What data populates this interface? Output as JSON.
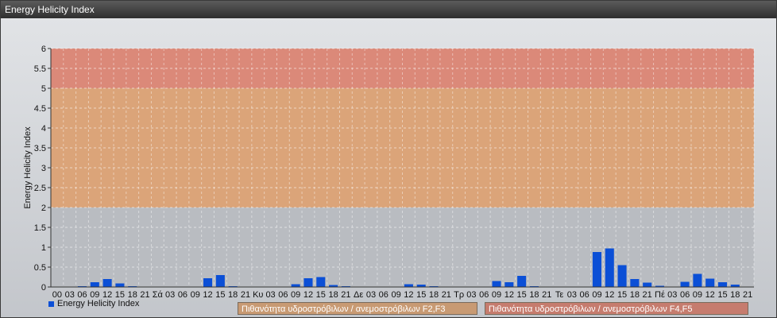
{
  "window": {
    "title": "Energy Helicity Index"
  },
  "chart_data": {
    "type": "bar",
    "ylabel": "Energy Helicity Index",
    "ylim": [
      0,
      6
    ],
    "yticks": [
      "0",
      "0.5",
      "1",
      "1.5",
      "2",
      "2.5",
      "3",
      "3.5",
      "4",
      "4.5",
      "5",
      "5.5",
      "6"
    ],
    "bands": [
      {
        "from": 2,
        "to": 5,
        "color": "#e0a06c"
      },
      {
        "from": 5,
        "to": 6,
        "color": "#e0806c"
      }
    ],
    "categories": [
      "00",
      "03",
      "06",
      "09",
      "12",
      "15",
      "18",
      "21",
      "Σά",
      "03",
      "06",
      "09",
      "12",
      "15",
      "18",
      "21",
      "Κυ",
      "03",
      "06",
      "09",
      "12",
      "15",
      "18",
      "21",
      "Δε",
      "03",
      "06",
      "09",
      "12",
      "15",
      "18",
      "21",
      "Τρ",
      "03",
      "06",
      "09",
      "12",
      "15",
      "18",
      "21",
      "Τε",
      "03",
      "06",
      "09",
      "12",
      "15",
      "18",
      "21",
      "Πέ",
      "03",
      "06",
      "09",
      "12",
      "15",
      "18",
      "21"
    ],
    "series": [
      {
        "name": "Energy Helicity Index",
        "color": "#0b4fd6",
        "values": [
          0.01,
          0.01,
          0.02,
          0.12,
          0.2,
          0.09,
          0.02,
          0.01,
          0.01,
          0.01,
          0.01,
          0.01,
          0.22,
          0.3,
          0.02,
          0.01,
          0.01,
          0.01,
          0.01,
          0.07,
          0.22,
          0.25,
          0.05,
          0.02,
          0.01,
          0.01,
          0.01,
          0.01,
          0.07,
          0.06,
          0.02,
          0.01,
          0.01,
          0.01,
          0.01,
          0.15,
          0.12,
          0.28,
          0.02,
          0.01,
          0.01,
          0.01,
          0.01,
          0.88,
          0.97,
          0.55,
          0.2,
          0.11,
          0.03,
          0.01,
          0.13,
          0.33,
          0.21,
          0.12,
          0.06,
          0.01
        ]
      }
    ]
  },
  "legend": {
    "label": "Energy Helicity Index",
    "color": "#0b4fd6"
  },
  "buttons": {
    "f23": "Πιθανότητα υδροστρόβιλων / ανεμοστρόβιλων F2,F3",
    "f45": "Πιθανότητα υδροστρόβιλων / ανεμοστρόβιλων F4,F5"
  }
}
